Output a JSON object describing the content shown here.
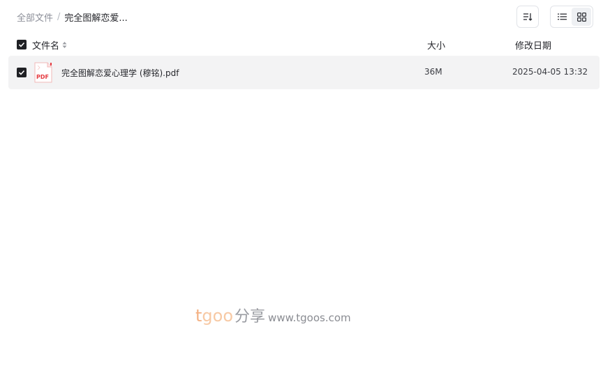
{
  "breadcrumb": {
    "root": "全部文件",
    "separator": "/",
    "current": "完全图解恋爱..."
  },
  "toolbar": {
    "sort_icon": "sort-icon",
    "list_view_icon": "list-view-icon",
    "grid_view_icon": "grid-view-icon"
  },
  "table": {
    "headers": {
      "name": "文件名",
      "size": "大小",
      "date": "修改日期"
    },
    "rows": [
      {
        "icon": "pdf-file-icon",
        "icon_label": "PDF",
        "name": "完全图解恋爱心理学 (穆铭).pdf",
        "size": "36M",
        "date": "2025-04-05 13:32",
        "checked": true
      }
    ]
  },
  "watermark": {
    "t": "t",
    "goo": "goo",
    "cn": "分享",
    "url": "www.tgoos.com"
  },
  "colors": {
    "accent": "#1f2024",
    "row_bg": "#f3f3f4",
    "pdf_red": "#e5393f"
  }
}
